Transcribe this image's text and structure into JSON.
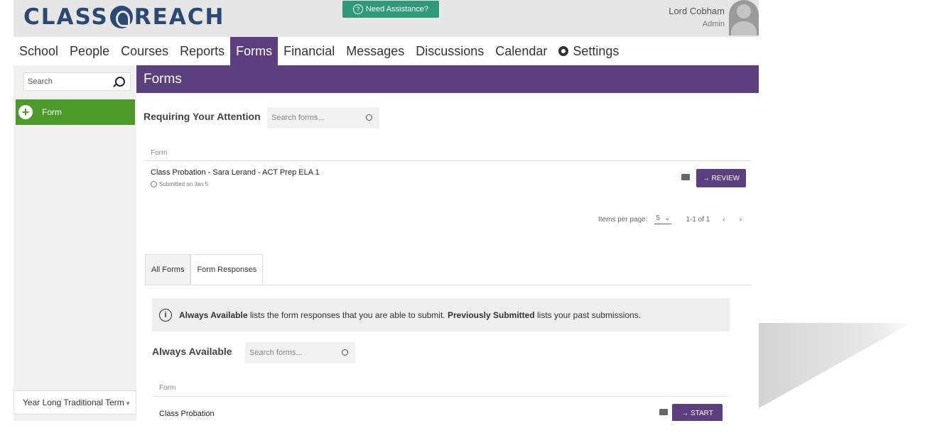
{
  "header": {
    "logo_text_left": "CLASS",
    "logo_text_right": "REACH",
    "assistance_label": "Need Assistance?",
    "user_name": "Lord Cobham",
    "user_role": "Admin"
  },
  "nav": {
    "items": [
      {
        "label": "School"
      },
      {
        "label": "People"
      },
      {
        "label": "Courses"
      },
      {
        "label": "Reports"
      },
      {
        "label": "Forms",
        "active": true
      },
      {
        "label": "Financial"
      },
      {
        "label": "Messages"
      },
      {
        "label": "Discussions"
      },
      {
        "label": "Calendar"
      },
      {
        "label": "Settings"
      }
    ]
  },
  "sidebar": {
    "search_placeholder": "Search",
    "form_button_label": "Form",
    "term_label": "Year Long Traditional Term"
  },
  "main": {
    "title": "Forms",
    "attention": {
      "title": "Requiring Your Attention",
      "search_placeholder": "Search forms...",
      "column_header": "Form",
      "rows": [
        {
          "title": "Class Probation - Sara Lerand - ACT Prep ELA 1",
          "subtitle": "Submitted on Jan 5",
          "action": "REVIEW"
        }
      ],
      "pager": {
        "items_per_page_label": "Items per page:",
        "items_per_page_value": "5",
        "range": "1-1 of 1"
      }
    },
    "tabs": [
      {
        "label": "All Forms"
      },
      {
        "label": "Form Responses",
        "active": true
      }
    ],
    "info": {
      "bold1": "Always Available",
      "text1": " lists the form responses that you are able to submit. ",
      "bold2": "Previously Submitted",
      "text2": " lists your past submissions."
    },
    "available": {
      "title": "Always Available",
      "search_placeholder": "Search forms...",
      "column_header": "Form",
      "rows": [
        {
          "title": "Class Probation",
          "action": "START"
        }
      ]
    }
  },
  "colors": {
    "purple": "#5b3f7f",
    "green": "#4c9a2a",
    "teal": "#2e9a7a",
    "logo_blue": "#2b4a73"
  }
}
